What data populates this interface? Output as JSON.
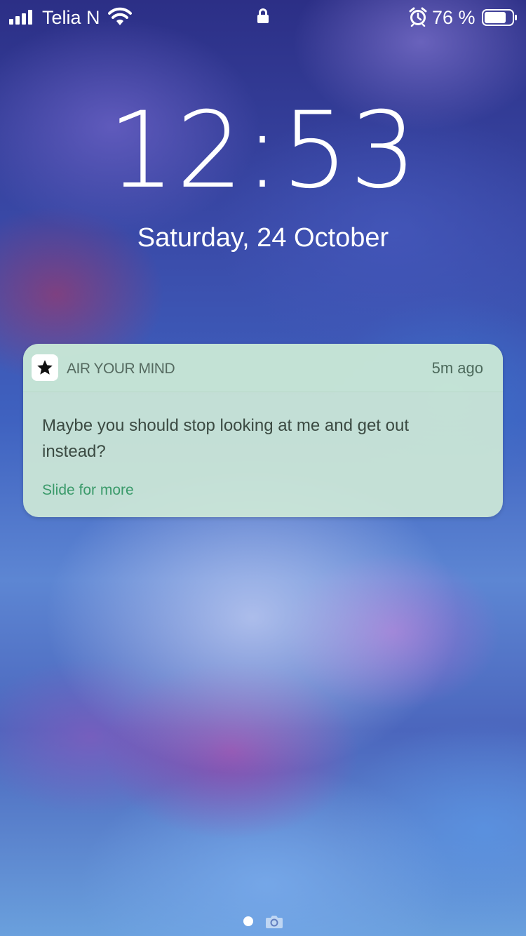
{
  "status_bar": {
    "carrier": "Telia N",
    "battery_percent": "76 %",
    "icons": [
      "signal-icon",
      "wifi-icon",
      "lock-icon",
      "alarm-icon",
      "battery-icon"
    ]
  },
  "lock_screen": {
    "time": "12:53",
    "date": "Saturday, 24 October"
  },
  "notification": {
    "app_name": "AIR YOUR MIND",
    "app_icon": "star-icon",
    "time_ago": "5m ago",
    "message": "Maybe you should stop looking at me and get out instead?",
    "action_hint": "Slide for more"
  },
  "bottom": {
    "icons": [
      "page-dot",
      "camera-icon"
    ]
  },
  "colors": {
    "notification_bg": "#cde8d7",
    "action_green": "#3a9a6a"
  }
}
